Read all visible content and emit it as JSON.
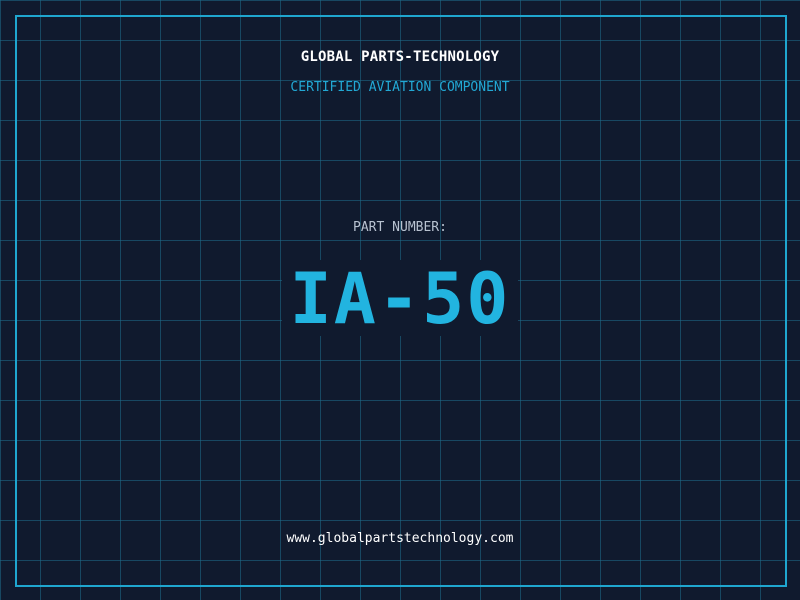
{
  "header": {
    "company": "GLOBAL PARTS-TECHNOLOGY",
    "tagline": "CERTIFIED AVIATION COMPONENT"
  },
  "part": {
    "label": "PART NUMBER:",
    "number": "IA-50"
  },
  "footer": {
    "url": "www.globalpartstechnology.com"
  },
  "colors": {
    "background": "#101a2e",
    "grid": "#1e6e8c",
    "frame": "#1fa6cf",
    "accent": "#22b4e0",
    "label": "#b8c2d0",
    "text": "#ffffff"
  }
}
